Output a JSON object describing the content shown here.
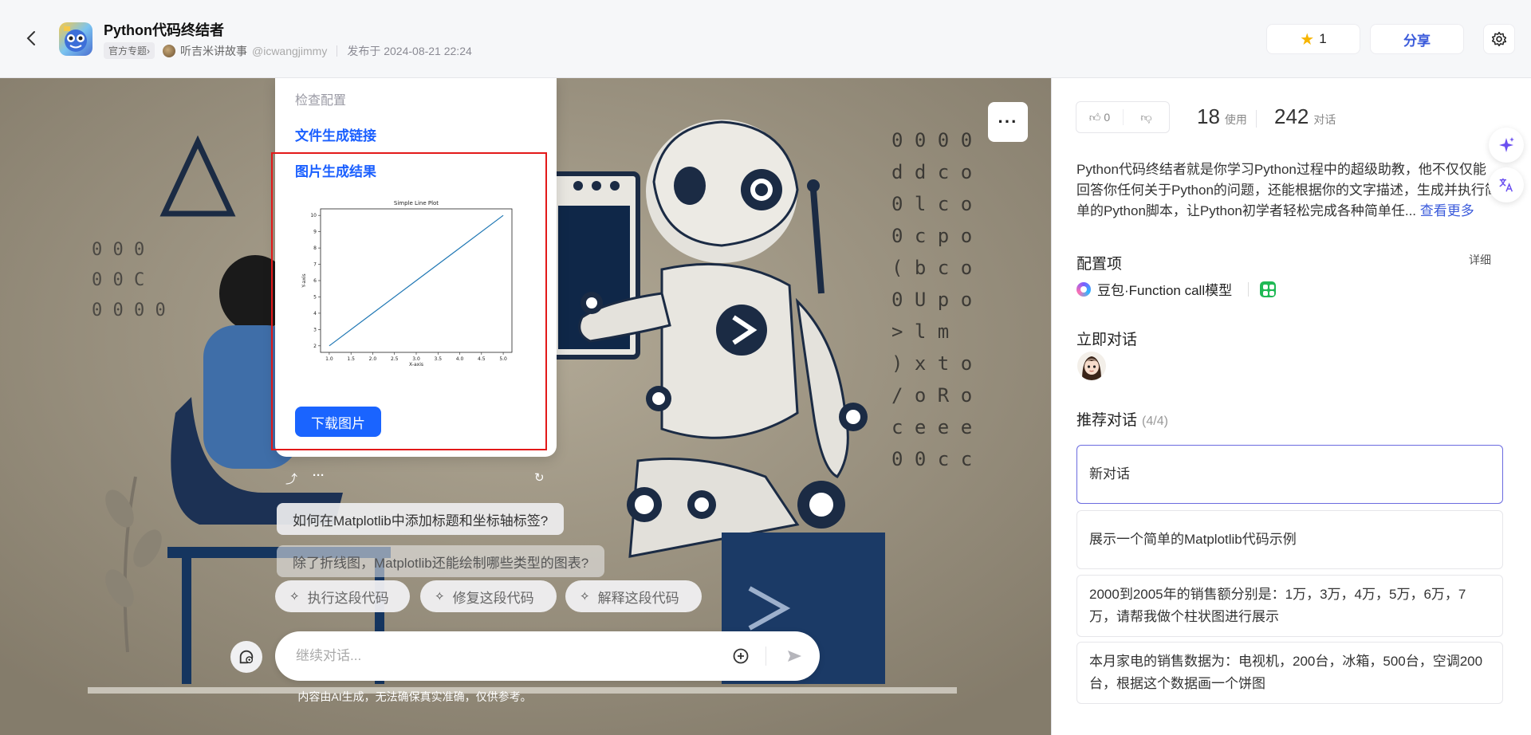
{
  "header": {
    "title": "Python代码终结者",
    "official_tag": "官方专题›",
    "author_name": "听吉米讲故事",
    "author_handle": "@icwangjimmy",
    "published": "发布于 2024-08-21 22:24",
    "star_count": "1",
    "share_label": "分享"
  },
  "chat": {
    "check_config": "检查配置",
    "file_link": "文件生成链接",
    "image_result": "图片生成结果",
    "download_label": "下载图片",
    "suggestions": [
      "如何在Matplotlib中添加标题和坐标轴标签?",
      "除了折线图，Matplotlib还能绘制哪些类型的图表?"
    ],
    "chips": [
      "执行这段代码",
      "修复这段代码",
      "解释这段代码"
    ],
    "input_placeholder": "继续对话...",
    "disclaimer": "内容由AI生成，无法确保真实准确，仅供参考。"
  },
  "chart_data": {
    "type": "line",
    "title": "Simple Line Plot",
    "xlabel": "X-axis",
    "ylabel": "Y-axis",
    "x": [
      1,
      2,
      3,
      4,
      5
    ],
    "y": [
      2,
      4,
      6,
      8,
      10
    ],
    "xlim": [
      0.8,
      5.2
    ],
    "ylim": [
      1.6,
      10.4
    ],
    "xticks": [
      "1.0",
      "1.5",
      "2.0",
      "2.5",
      "3.0",
      "3.5",
      "4.0",
      "4.5",
      "5.0"
    ],
    "yticks": [
      "2",
      "3",
      "4",
      "5",
      "6",
      "7",
      "8",
      "9",
      "10"
    ],
    "line_color": "#1f77b4",
    "grid": false
  },
  "side": {
    "likes": "0",
    "uses_num": "18",
    "uses_label": "使用",
    "chats_num": "242",
    "chats_label": "对话",
    "description": "Python代码终结者就是你学习Python过程中的超级助教，他不仅仅能回答你任何关于Python的问题，还能根据你的文字描述，生成并执行简单的Python脚本，让Python初学者轻松完成各种简单任...",
    "see_more": "查看更多",
    "config_title": "配置项",
    "detail": "详细",
    "model_name": "豆包·Function call模型",
    "chat_now": "立即对话",
    "recommended_title": "推荐对话",
    "recommended_count": "(4/4)",
    "recommended": [
      "新对话",
      "展示一个简单的Matplotlib代码示例",
      "2000到2005年的销售额分别是：1万，3万，4万，5万，6万，7万，请帮我做个柱状图进行展示",
      "本月家电的销售数据为：电视机，200台，冰箱，500台，空调200台，根据这个数据画一个饼图"
    ]
  },
  "colors": {
    "accent": "#1a64ff",
    "highlight_border": "#e31919",
    "star": "#f7b500"
  }
}
